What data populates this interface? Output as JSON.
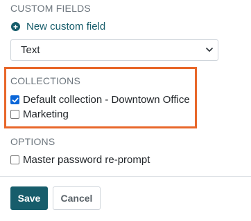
{
  "custom_fields": {
    "title": "CUSTOM FIELDS",
    "new_field_label": "New custom field",
    "type_select": {
      "value": "Text"
    }
  },
  "collections": {
    "title": "COLLECTIONS",
    "items": [
      {
        "label": "Default collection - Downtown Office",
        "checked": true
      },
      {
        "label": "Marketing",
        "checked": false
      }
    ],
    "highlight_color": "#e8672a"
  },
  "options": {
    "title": "OPTIONS",
    "master_password_reprompt": {
      "label": "Master password re-prompt",
      "checked": false
    }
  },
  "footer": {
    "save_label": "Save",
    "cancel_label": "Cancel"
  },
  "colors": {
    "primary": "#175d6b",
    "checkbox_checked": "#0a66d8"
  }
}
